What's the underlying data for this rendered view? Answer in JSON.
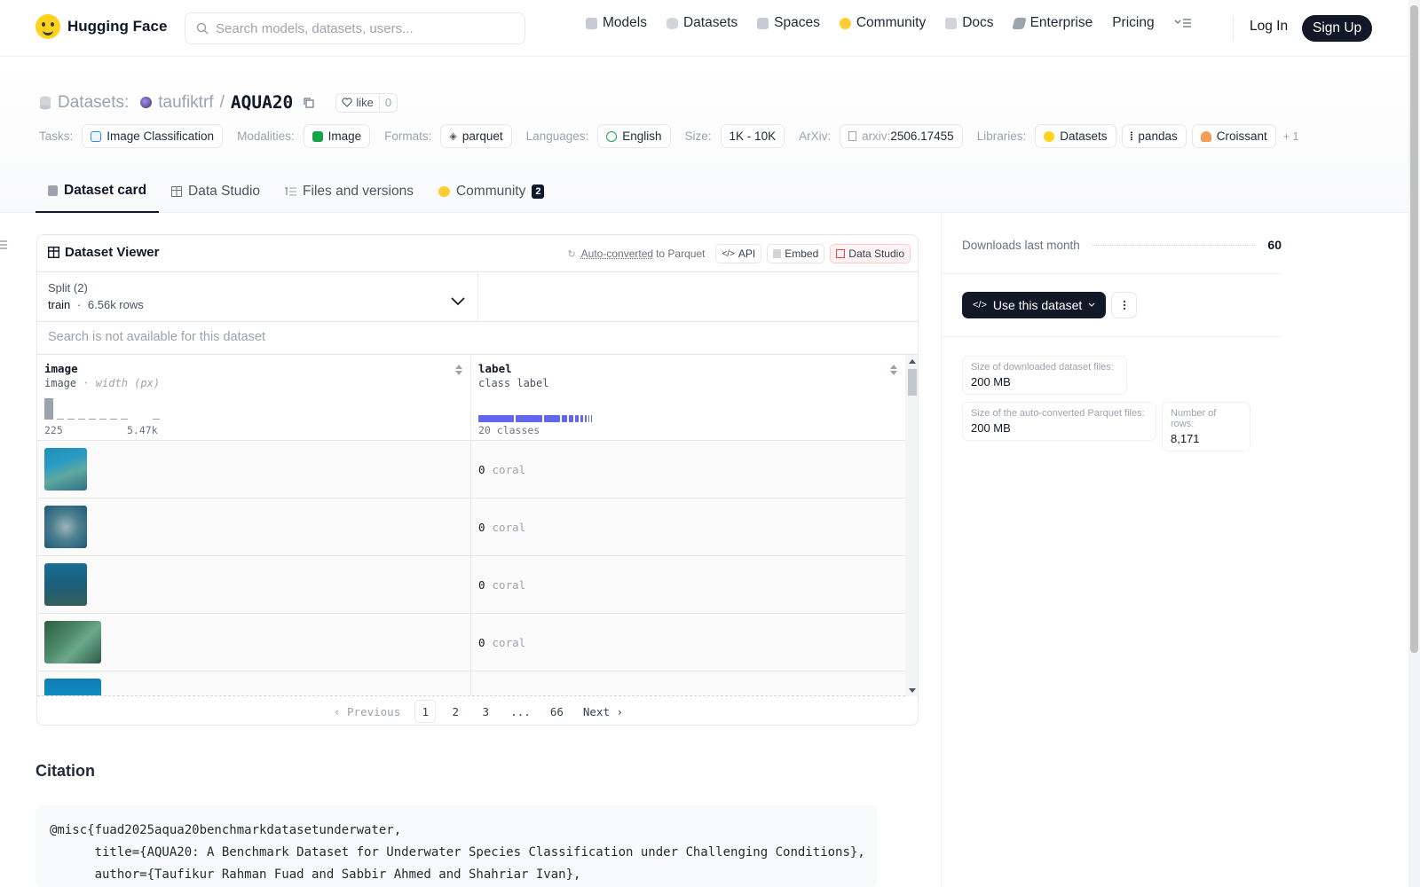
{
  "nav": {
    "brand": "Hugging Face",
    "search_placeholder": "Search models, datasets, users...",
    "links": [
      "Models",
      "Datasets",
      "Spaces",
      "Community",
      "Docs",
      "Enterprise",
      "Pricing"
    ],
    "login": "Log In",
    "signup": "Sign Up"
  },
  "header": {
    "section": "Datasets:",
    "owner": "taufiktrf",
    "separator": "/",
    "name": "AQUA20",
    "like_label": "like",
    "like_count": "0",
    "tags": {
      "tasks_label": "Tasks:",
      "task": "Image Classification",
      "modalities_label": "Modalities:",
      "modality": "Image",
      "formats_label": "Formats:",
      "format": "parquet",
      "languages_label": "Languages:",
      "language": "English",
      "size_label": "Size:",
      "size": "1K - 10K",
      "arxiv_label": "ArXiv:",
      "arxiv_prefix": "arxiv:",
      "arxiv_id": "2506.17455",
      "libraries_label": "Libraries:",
      "libraries": [
        "Datasets",
        "pandas",
        "Croissant"
      ],
      "more": "+ 1"
    },
    "tabs": [
      {
        "label": "Dataset card"
      },
      {
        "label": "Data Studio"
      },
      {
        "label": "Files and versions"
      },
      {
        "label": "Community",
        "badge": "2"
      }
    ]
  },
  "viewer": {
    "title": "Dataset Viewer",
    "auto_converted": "Auto-converted",
    "to_parquet": "to Parquet",
    "api": "API",
    "embed": "Embed",
    "data_studio": "Data Studio",
    "split_label": "Split (2)",
    "split_name": "train",
    "split_dot": "·",
    "split_rows": "6.56k rows",
    "search_unavailable": "Search is not available for this dataset",
    "columns": [
      {
        "name": "image",
        "dtype": "image",
        "extra": "· width (px)",
        "min": "225",
        "max": "5.47k"
      },
      {
        "name": "label",
        "dtype": "class label",
        "classes": "20 classes"
      }
    ],
    "rows": [
      {
        "label_id": "0",
        "label_name": "coral"
      },
      {
        "label_id": "0",
        "label_name": "coral"
      },
      {
        "label_id": "0",
        "label_name": "coral"
      },
      {
        "label_id": "0",
        "label_name": "coral"
      }
    ],
    "pager": {
      "previous": "Previous",
      "pages": [
        "1",
        "2",
        "3",
        "...",
        "66"
      ],
      "next": "Next"
    }
  },
  "citation": {
    "title": "Citation",
    "text": "@misc{fuad2025aqua20benchmarkdatasetunderwater,\n      title={AQUA20: A Benchmark Dataset for Underwater Species Classification under Challenging Conditions},\n      author={Taufikur Rahman Fuad and Sabbir Ahmed and Shahriar Ivan},"
  },
  "sidebar": {
    "downloads_label": "Downloads last month",
    "downloads_value": "60",
    "use_dataset": "Use this dataset",
    "stats": [
      {
        "k": "Size of downloaded dataset files:",
        "v": "200 MB"
      },
      {
        "k": "Size of the auto-converted Parquet files:",
        "v": "200 MB"
      },
      {
        "k": "Number of rows:",
        "v": "8,171"
      }
    ]
  },
  "colors": {
    "accent_dark": "#111827",
    "indigo": "#6366f1",
    "yellow": "#ffd21e"
  }
}
